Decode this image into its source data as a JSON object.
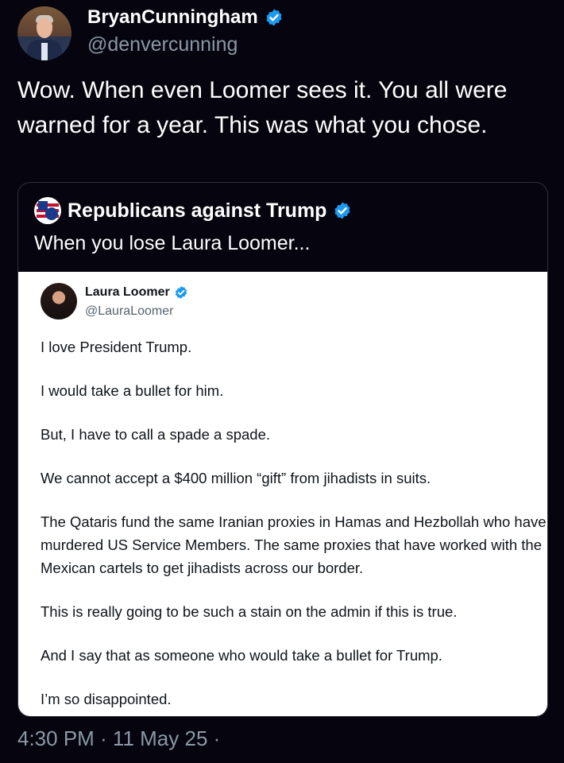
{
  "tweet": {
    "author_name": "BryanCunningham",
    "author_handle": "@denvercunning",
    "text": "Wow. When even Loomer sees it. You all were warned for a year. This was what you chose.",
    "timestamp": "4:30 PM · 11 May 25 ·"
  },
  "quote": {
    "author_name": "Republicans against Trump",
    "avatar_label": "RAT",
    "text": "When you lose Laura Loomer..."
  },
  "embedded_post": {
    "author_name": "Laura Loomer",
    "author_handle": "@LauraLoomer",
    "paragraphs": [
      "I love President Trump.",
      "I would take a bullet for him.",
      "But, I have to call a spade a spade.",
      "We cannot accept a $400 million “gift” from jihadists in suits.",
      "The Qataris fund the same Iranian proxies in Hamas and Hezbollah who have murdered US Service Members. The same proxies that have worked with the Mexican cartels to get jihadists across our border.",
      "This is really going to be such a stain on the admin if this is true.",
      "And I say that as someone who would take a bullet for Trump.",
      "I’m so disappointed."
    ]
  },
  "colors": {
    "background": "#05040f",
    "verified": "#1d9bf0",
    "secondary_text": "#8b98a5"
  },
  "icons": {
    "verified": "verified-badge-icon"
  }
}
